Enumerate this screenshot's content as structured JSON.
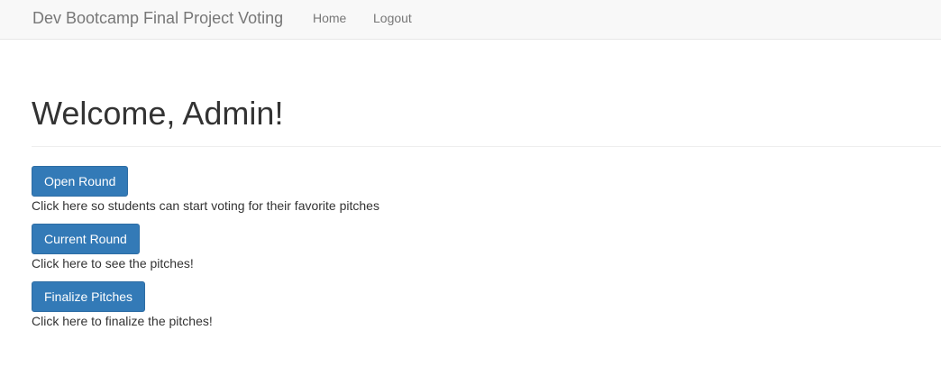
{
  "navbar": {
    "brand": "Dev Bootcamp Final Project Voting",
    "links": [
      {
        "label": "Home"
      },
      {
        "label": "Logout"
      }
    ]
  },
  "main": {
    "title": "Welcome, Admin!",
    "actions": [
      {
        "button_label": "Open Round",
        "description": "Click here so students can start voting for their favorite pitches"
      },
      {
        "button_label": "Current Round",
        "description": "Click here to see the pitches!"
      },
      {
        "button_label": "Finalize Pitches",
        "description": "Click here to finalize the pitches!"
      }
    ]
  },
  "colors": {
    "navbar_background": "#f8f8f8",
    "primary_button": "#337ab7",
    "text": "#333333",
    "nav_text": "#777777"
  }
}
